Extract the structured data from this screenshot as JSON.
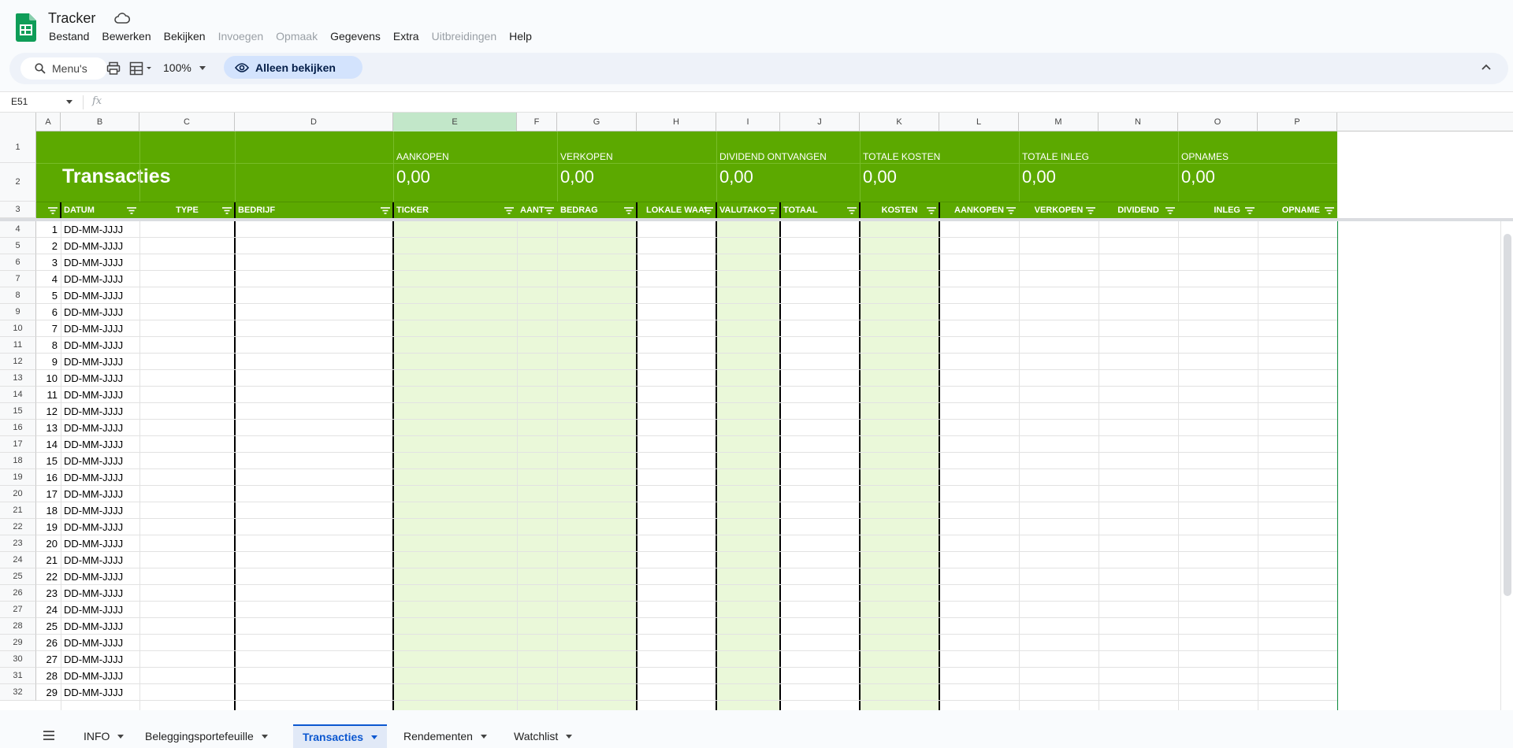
{
  "app": {
    "title": "Tracker"
  },
  "menu": [
    "Bestand",
    "Bewerken",
    "Bekijken",
    "Invoegen",
    "Opmaak",
    "Gegevens",
    "Extra",
    "Uitbreidingen",
    "Help"
  ],
  "menu_disabled": [
    false,
    false,
    false,
    true,
    true,
    false,
    false,
    true,
    false
  ],
  "toolbar": {
    "search_label": "Menu's",
    "zoom": "100%",
    "view_only_label": "Alleen bekijken"
  },
  "formula_bar": {
    "cell_ref": "E51",
    "fx": "fx"
  },
  "columns": [
    "A",
    "B",
    "C",
    "D",
    "E",
    "F",
    "G",
    "H",
    "I",
    "J",
    "K",
    "L",
    "M",
    "N",
    "O",
    "P"
  ],
  "active_column": "E",
  "row_numbers_top": [
    "1",
    "2",
    "3"
  ],
  "summary": {
    "title": "Transacties",
    "items": [
      {
        "label": "AANKOPEN",
        "value": "0,00"
      },
      {
        "label": "VERKOPEN",
        "value": "0,00"
      },
      {
        "label": "DIVIDEND ONTVANGEN",
        "value": "0,00"
      },
      {
        "label": "TOTALE KOSTEN",
        "value": "0,00"
      },
      {
        "label": "TOTALE INLEG",
        "value": "0,00"
      },
      {
        "label": "OPNAMES",
        "value": "0,00"
      }
    ]
  },
  "headers": [
    "",
    "DATUM",
    "TYPE",
    "BEDRIJF",
    "TICKER",
    "AANT",
    "BEDRAG",
    "LOKALE WAAI",
    "VALUTAKO",
    "TOTAAL",
    "KOSTEN",
    "AANKOPEN",
    "VERKOPEN",
    "DIVIDEND",
    "INLEG",
    "OPNAME"
  ],
  "rows": [
    {
      "row": "4",
      "n": "1",
      "date": "DD-MM-JJJJ"
    },
    {
      "row": "5",
      "n": "2",
      "date": "DD-MM-JJJJ"
    },
    {
      "row": "6",
      "n": "3",
      "date": "DD-MM-JJJJ"
    },
    {
      "row": "7",
      "n": "4",
      "date": "DD-MM-JJJJ"
    },
    {
      "row": "8",
      "n": "5",
      "date": "DD-MM-JJJJ"
    },
    {
      "row": "9",
      "n": "6",
      "date": "DD-MM-JJJJ"
    },
    {
      "row": "10",
      "n": "7",
      "date": "DD-MM-JJJJ"
    },
    {
      "row": "11",
      "n": "8",
      "date": "DD-MM-JJJJ"
    },
    {
      "row": "12",
      "n": "9",
      "date": "DD-MM-JJJJ"
    },
    {
      "row": "13",
      "n": "10",
      "date": "DD-MM-JJJJ"
    },
    {
      "row": "14",
      "n": "11",
      "date": "DD-MM-JJJJ"
    },
    {
      "row": "15",
      "n": "12",
      "date": "DD-MM-JJJJ"
    },
    {
      "row": "16",
      "n": "13",
      "date": "DD-MM-JJJJ"
    },
    {
      "row": "17",
      "n": "14",
      "date": "DD-MM-JJJJ"
    },
    {
      "row": "18",
      "n": "15",
      "date": "DD-MM-JJJJ"
    },
    {
      "row": "19",
      "n": "16",
      "date": "DD-MM-JJJJ"
    },
    {
      "row": "20",
      "n": "17",
      "date": "DD-MM-JJJJ"
    },
    {
      "row": "21",
      "n": "18",
      "date": "DD-MM-JJJJ"
    },
    {
      "row": "22",
      "n": "19",
      "date": "DD-MM-JJJJ"
    },
    {
      "row": "23",
      "n": "20",
      "date": "DD-MM-JJJJ"
    },
    {
      "row": "24",
      "n": "21",
      "date": "DD-MM-JJJJ"
    },
    {
      "row": "25",
      "n": "22",
      "date": "DD-MM-JJJJ"
    },
    {
      "row": "26",
      "n": "23",
      "date": "DD-MM-JJJJ"
    },
    {
      "row": "27",
      "n": "24",
      "date": "DD-MM-JJJJ"
    },
    {
      "row": "28",
      "n": "25",
      "date": "DD-MM-JJJJ"
    },
    {
      "row": "29",
      "n": "26",
      "date": "DD-MM-JJJJ"
    },
    {
      "row": "30",
      "n": "27",
      "date": "DD-MM-JJJJ"
    },
    {
      "row": "31",
      "n": "28",
      "date": "DD-MM-JJJJ"
    },
    {
      "row": "32",
      "n": "29",
      "date": "DD-MM-JJJJ"
    }
  ],
  "sheet_tabs": [
    {
      "label": "INFO",
      "active": false
    },
    {
      "label": "Beleggingsportefeuille",
      "active": false
    },
    {
      "label": "Transacties",
      "active": true
    },
    {
      "label": "Rendementen",
      "active": false
    },
    {
      "label": "Watchlist",
      "active": false
    }
  ],
  "colors": {
    "band_green": "#5ca900",
    "light_green": "#eaf8d9",
    "accent": "#0b57d0"
  }
}
